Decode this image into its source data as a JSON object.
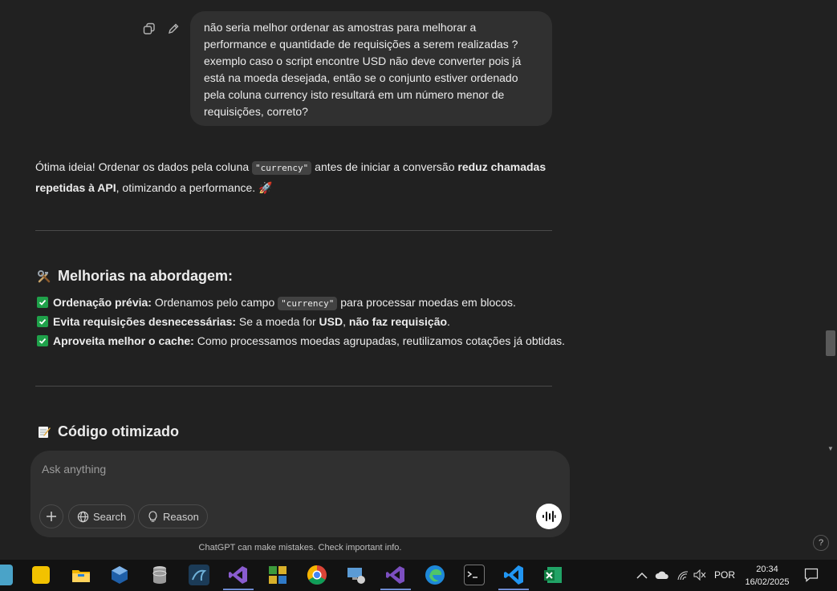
{
  "user_message": {
    "lines": [
      "não seria melhor ordenar as amostras para melhorar a",
      "performance e quantidade de requisições a serem realizadas ?",
      "exemplo caso o script encontre USD não deve converter pois já",
      "está na moeda desejada, então se o conjunto estiver ordenado",
      "pela coluna currency isto resultará em um número menor de",
      "requisições, correto?"
    ]
  },
  "assistant": {
    "intro_a": "Ótima ideia! Ordenar os dados pela coluna ",
    "intro_code": "\"currency\"",
    "intro_b": " antes de iniciar a conversão ",
    "intro_bold": "reduz chamadas repetidas à API",
    "intro_c": ", otimizando a performance. 🚀",
    "section1_title": "Melhorias na abordagem:",
    "items": [
      {
        "bold": "Ordenação prévia:",
        "text_a": " Ordenamos pelo campo ",
        "code": "\"currency\"",
        "text_b": " para processar moedas em blocos."
      },
      {
        "bold": "Evita requisições desnecessárias:",
        "text_a": " Se a moeda for ",
        "bold2": "USD",
        "text_b": ", ",
        "bold3": "não faz requisição",
        "text_c": "."
      },
      {
        "bold": "Aproveita melhor o cache:",
        "text_a": " Como processamos moedas agrupadas, reutilizamos cotações já obtidas."
      }
    ],
    "section2_title": "Código otimizado"
  },
  "composer": {
    "placeholder": "Ask anything",
    "search_label": "Search",
    "reason_label": "Reason"
  },
  "footer_note": "ChatGPT can make mistakes. Check important info.",
  "help_label": "?",
  "taskbar": {
    "language": "POR",
    "time": "20:34",
    "date": "16/02/2025"
  }
}
